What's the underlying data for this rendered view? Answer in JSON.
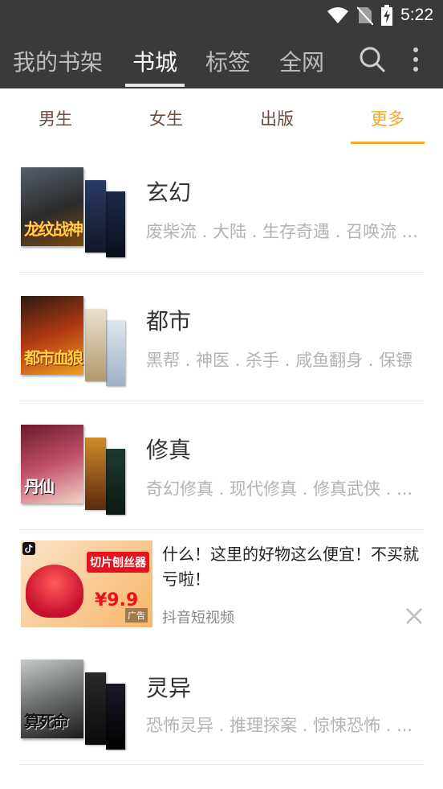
{
  "status": {
    "time": "5:22"
  },
  "topnav": {
    "tabs": [
      "我的书架",
      "书城",
      "标签",
      "全网"
    ],
    "active_tab": "书城",
    "icons": [
      "search-icon",
      "more-vertical-icon"
    ]
  },
  "subnav": {
    "tabs": [
      "男生",
      "女生",
      "出版",
      "更多"
    ],
    "active_tab": "更多",
    "accent_color": "#f5a623"
  },
  "categories": [
    {
      "name": "玄幻",
      "tags": "废柴流 . 大陆 . 生存奇遇 . 召唤流 ...",
      "cover_title": "龙纹战神"
    },
    {
      "name": "都市",
      "tags": "黑帮 . 神医 . 杀手 . 咸鱼翻身 . 保镖",
      "cover_title": "都市血狼"
    },
    {
      "name": "修真",
      "tags": "奇幻修真 . 现代修真 . 修真武侠 . ...",
      "cover_title": "丹仙"
    },
    {
      "name": "灵异",
      "tags": "恐怖灵异 . 推理探案 . 惊悚恐怖 . ...",
      "cover_title": "算死命"
    }
  ],
  "ad": {
    "headline": "什么！这里的好物这么便宜！不买就亏啦！",
    "source": "抖音短视频",
    "image_title": "切片刨丝器",
    "image_price": "¥9.9",
    "image_badge": "广告"
  },
  "colors": {
    "topbar": "#3a3a3a",
    "accent": "#f5a623",
    "subtab_text": "#6d4c41"
  }
}
